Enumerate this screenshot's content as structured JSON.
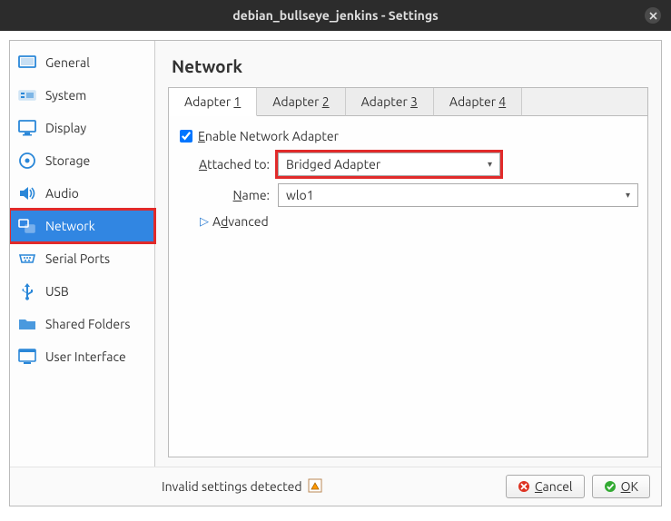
{
  "window": {
    "title": "debian_bullseye_jenkins - Settings"
  },
  "sidebar": {
    "items": [
      {
        "label": "General",
        "icon": "general"
      },
      {
        "label": "System",
        "icon": "system"
      },
      {
        "label": "Display",
        "icon": "display"
      },
      {
        "label": "Storage",
        "icon": "storage"
      },
      {
        "label": "Audio",
        "icon": "audio"
      },
      {
        "label": "Network",
        "icon": "network",
        "selected": true,
        "highlighted": true
      },
      {
        "label": "Serial Ports",
        "icon": "serial"
      },
      {
        "label": "USB",
        "icon": "usb"
      },
      {
        "label": "Shared Folders",
        "icon": "shared"
      },
      {
        "label": "User Interface",
        "icon": "ui"
      }
    ]
  },
  "page": {
    "title": "Network"
  },
  "tabs": [
    {
      "label_pre": "Adapter ",
      "label_accel": "1",
      "active": true
    },
    {
      "label_pre": "Adapter ",
      "label_accel": "2"
    },
    {
      "label_pre": "Adapter ",
      "label_accel": "3"
    },
    {
      "label_pre": "Adapter ",
      "label_accel": "4"
    }
  ],
  "adapter": {
    "enable_checked": true,
    "enable_label_accel": "E",
    "enable_label_rest": "nable Network Adapter",
    "attached_label_accel": "A",
    "attached_label_rest": "ttached to:",
    "attached_value": "Bridged Adapter",
    "name_label_accel": "N",
    "name_label_rest": "ame:",
    "name_value": "wlo1",
    "advanced_label_accel": "d",
    "advanced_label_pre": "A",
    "advanced_label_rest": "vanced"
  },
  "footer": {
    "invalid_text": "Invalid settings detected",
    "cancel_accel": "C",
    "cancel_rest": "ancel",
    "ok_accel": "O",
    "ok_rest": "K"
  }
}
